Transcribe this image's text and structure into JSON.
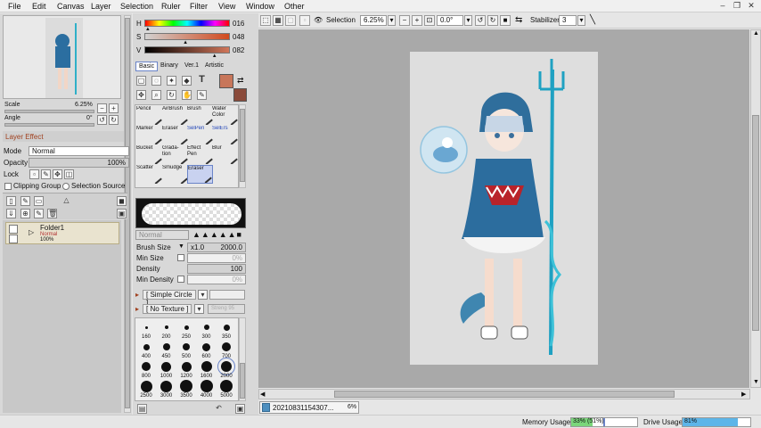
{
  "menu": [
    "File",
    "Edit",
    "Canvas",
    "Layer",
    "Selection",
    "Ruler",
    "Filter",
    "View",
    "Window",
    "Other"
  ],
  "window_buttons": [
    "–",
    "❐",
    "✕"
  ],
  "navigator": {
    "scale_label": "Scale",
    "scale_value": "6.25%",
    "angle_label": "Angle",
    "angle_value": "0°"
  },
  "layer_effect": {
    "title": "Layer Effect",
    "mode_label": "Mode",
    "mode_value": "Normal",
    "opacity_label": "Opacity",
    "opacity_value": "100%",
    "lock_label": "Lock",
    "clipping_group": "Clipping Group",
    "selection_source": "Selection Source"
  },
  "layer": {
    "name": "Folder1",
    "blend": "Normal",
    "opacity": "100%"
  },
  "color": {
    "h_label": "H",
    "h_value": "016",
    "s_label": "S",
    "s_value": "048",
    "v_label": "V",
    "v_value": "082",
    "primary": "#c8765a",
    "secondary": "#8a4a3a",
    "h_level": 0.04,
    "s_level": 0.48,
    "v_level": 0.82
  },
  "color_tabs": [
    "Basic",
    "Binary",
    "Ver.1",
    "Artistic"
  ],
  "tools": [
    [
      "Pencil",
      "AirBrush",
      "Brush",
      "Water Color"
    ],
    [
      "Marker",
      "Eraser",
      "SelPen",
      "SelErs"
    ],
    [
      "Bucket",
      "Grada-\ntion",
      "Effect\nPen",
      "Blur"
    ],
    [
      "Scatter",
      "Smudge",
      "Eraser",
      ""
    ]
  ],
  "brush": {
    "blend": "Normal",
    "size_label": "Brush Size",
    "size_mult": "x1.0",
    "size_value": "2000.0",
    "min_size_label": "Min Size",
    "min_size_value": "0%",
    "density_label": "Density",
    "density_value": "100",
    "min_density_label": "Min Density",
    "min_density_value": "0%",
    "shape": "[ Simple Circle ]",
    "texture": "[ No Texture ]",
    "texture_strength": "Streng 95"
  },
  "brush_sizes": [
    [
      "160",
      "200",
      "250",
      "300",
      "350"
    ],
    [
      "400",
      "450",
      "500",
      "600",
      "700"
    ],
    [
      "800",
      "1000",
      "1200",
      "1600",
      "2000"
    ],
    [
      "2500",
      "3000",
      "3500",
      "4000",
      "5000"
    ]
  ],
  "toolbar": {
    "selection_label": "Selection",
    "zoom": "6.25%",
    "angle": "0.0°",
    "stabilizer_label": "Stabilizer",
    "stabilizer_value": "3"
  },
  "doc_tab": {
    "name": "20210831154307...",
    "zoom": "6%"
  },
  "status": {
    "memory_label": "Memory Usage",
    "memory_value": "33% (51%)",
    "memory_level": 0.33,
    "drive_label": "Drive Usage",
    "drive_value": "81%",
    "drive_level": 0.81
  }
}
